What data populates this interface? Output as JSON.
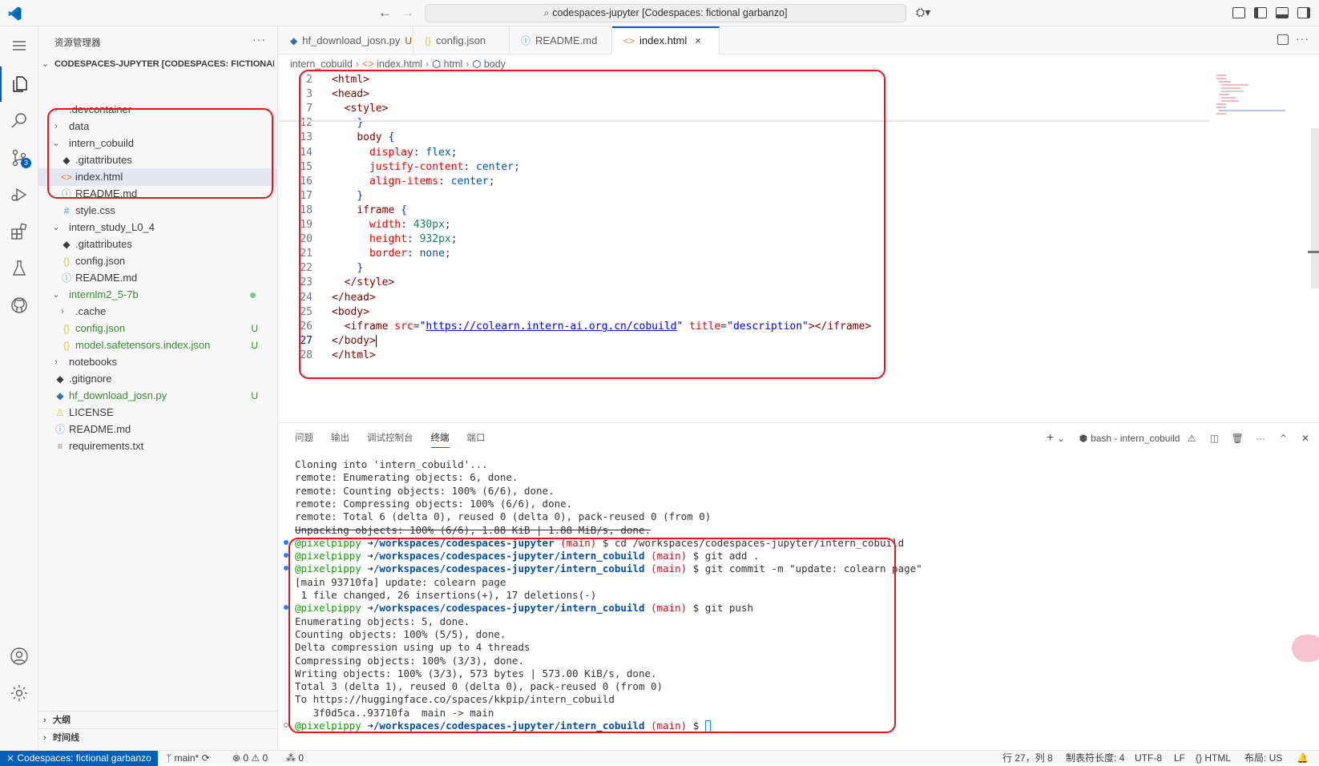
{
  "titlebar": {
    "search_text": "codespaces-jupyter [Codespaces: fictional garbanzo]",
    "back_glyph": "←",
    "forward_glyph": "→",
    "copilot_glyph": "⛭▾"
  },
  "sidebar": {
    "title": "资源管理器",
    "more_glyph": "···",
    "root_label": "CODESPACES-JUPYTER [CODESPACES: FICTIONAL G...",
    "rows": [
      {
        "indent": 1,
        "type": "folder",
        "open": false,
        "name": ".devcontainer",
        "color": "#3b3b3b",
        "status": ""
      },
      {
        "indent": 1,
        "type": "folder",
        "open": false,
        "name": "data",
        "color": "#3b3b3b",
        "status": ""
      },
      {
        "indent": 1,
        "type": "folder",
        "open": true,
        "name": "intern_cobuild",
        "color": "#3b3b3b",
        "status": ""
      },
      {
        "indent": 2,
        "type": "file",
        "icon": "git",
        "name": ".gitattributes",
        "color": "#3b3b3b",
        "status": ""
      },
      {
        "indent": 2,
        "type": "file",
        "icon": "html",
        "name": "index.html",
        "color": "#3b3b3b",
        "status": "",
        "selected": true
      },
      {
        "indent": 2,
        "type": "file",
        "icon": "info",
        "name": "README.md",
        "color": "#3b3b3b",
        "status": ""
      },
      {
        "indent": 2,
        "type": "file",
        "icon": "css",
        "name": "style.css",
        "color": "#3b3b3b",
        "status": ""
      },
      {
        "indent": 1,
        "type": "folder",
        "open": true,
        "name": "intern_study_L0_4",
        "color": "#3b3b3b",
        "status": ""
      },
      {
        "indent": 2,
        "type": "file",
        "icon": "git",
        "name": ".gitattributes",
        "color": "#3b3b3b",
        "status": ""
      },
      {
        "indent": 2,
        "type": "file",
        "icon": "json",
        "name": "config.json",
        "color": "#3b3b3b",
        "status": ""
      },
      {
        "indent": 2,
        "type": "file",
        "icon": "info",
        "name": "README.md",
        "color": "#3b3b3b",
        "status": ""
      },
      {
        "indent": 1,
        "type": "folder",
        "open": true,
        "name": "internlm2_5-7b",
        "color": "#388a34",
        "status": "dot"
      },
      {
        "indent": 2,
        "type": "folder",
        "open": false,
        "name": ".cache",
        "color": "#3b3b3b",
        "status": ""
      },
      {
        "indent": 2,
        "type": "file",
        "icon": "json",
        "name": "config.json",
        "color": "#388a34",
        "status": "U"
      },
      {
        "indent": 2,
        "type": "file",
        "icon": "json",
        "name": "model.safetensors.index.json",
        "color": "#388a34",
        "status": "U"
      },
      {
        "indent": 1,
        "type": "folder",
        "open": false,
        "name": "notebooks",
        "color": "#3b3b3b",
        "status": ""
      },
      {
        "indent": 1,
        "type": "file",
        "icon": "git",
        "name": ".gitignore",
        "color": "#3b3b3b",
        "status": ""
      },
      {
        "indent": 1,
        "type": "file",
        "icon": "py",
        "name": "hf_download_josn.py",
        "color": "#388a34",
        "status": "U"
      },
      {
        "indent": 1,
        "type": "file",
        "icon": "license",
        "name": "LICENSE",
        "color": "#3b3b3b",
        "status": ""
      },
      {
        "indent": 1,
        "type": "file",
        "icon": "info",
        "name": "README.md",
        "color": "#3b3b3b",
        "status": ""
      },
      {
        "indent": 1,
        "type": "file",
        "icon": "txt",
        "name": "requirements.txt",
        "color": "#3b3b3b",
        "status": ""
      }
    ],
    "outline_label": "大纲",
    "timeline_label": "时间线"
  },
  "icons": {
    "git": {
      "glyph": "◆",
      "color": "#3b3b3b"
    },
    "html": {
      "glyph": "<>",
      "color": "#e37933"
    },
    "info": {
      "glyph": "ⓘ",
      "color": "#519aba"
    },
    "css": {
      "glyph": "#",
      "color": "#519aba"
    },
    "json": {
      "glyph": "{}",
      "color": "#cbcb41"
    },
    "py": {
      "glyph": "◆",
      "color": "#3572a5"
    },
    "license": {
      "glyph": "♙",
      "color": "#cbcb41"
    },
    "txt": {
      "glyph": "≡",
      "color": "#888888"
    }
  },
  "tabs": [
    {
      "label": "hf_download_josn.py",
      "icon": "py",
      "status": "U",
      "active": false
    },
    {
      "label": "config.json",
      "icon": "json",
      "status": "",
      "active": false
    },
    {
      "label": "README.md",
      "icon": "info",
      "status": "",
      "active": false
    },
    {
      "label": "index.html",
      "icon": "html",
      "status": "",
      "active": true,
      "close": "×"
    }
  ],
  "breadcrumb": [
    "intern_cobuild",
    "index.html",
    "html",
    "body"
  ],
  "editor": {
    "current_line": "27",
    "lines": [
      {
        "n": "2",
        "tokens": [
          [
            "tag",
            "<html>"
          ]
        ]
      },
      {
        "n": "3",
        "tokens": [
          [
            "tag",
            "<head>"
          ]
        ]
      },
      {
        "n": "7",
        "tokens": [
          [
            "pun",
            "  "
          ],
          [
            "tag",
            "<style>"
          ]
        ]
      },
      {
        "n": "12",
        "tokens": [
          [
            "pun",
            "    "
          ],
          [
            "brk",
            "}"
          ]
        ]
      },
      {
        "n": "13",
        "tokens": [
          [
            "pun",
            "    "
          ],
          [
            "sel",
            "body"
          ],
          [
            "pun",
            " "
          ],
          [
            "brk",
            "{"
          ]
        ]
      },
      {
        "n": "14",
        "tokens": [
          [
            "pun",
            "      "
          ],
          [
            "prop",
            "display"
          ],
          [
            "pun",
            ": "
          ],
          [
            "val",
            "flex"
          ],
          [
            "pun",
            ";"
          ]
        ]
      },
      {
        "n": "15",
        "tokens": [
          [
            "pun",
            "      "
          ],
          [
            "prop",
            "justify-content"
          ],
          [
            "pun",
            ": "
          ],
          [
            "val",
            "center"
          ],
          [
            "pun",
            ";"
          ]
        ]
      },
      {
        "n": "16",
        "tokens": [
          [
            "pun",
            "      "
          ],
          [
            "prop",
            "align-items"
          ],
          [
            "pun",
            ": "
          ],
          [
            "val",
            "center"
          ],
          [
            "pun",
            ";"
          ]
        ]
      },
      {
        "n": "17",
        "tokens": [
          [
            "pun",
            "    "
          ],
          [
            "brk",
            "}"
          ]
        ]
      },
      {
        "n": "18",
        "tokens": [
          [
            "pun",
            "    "
          ],
          [
            "sel",
            "iframe"
          ],
          [
            "pun",
            " "
          ],
          [
            "brk",
            "{"
          ]
        ]
      },
      {
        "n": "19",
        "tokens": [
          [
            "pun",
            "      "
          ],
          [
            "prop",
            "width"
          ],
          [
            "pun",
            ": "
          ],
          [
            "num",
            "430px"
          ],
          [
            "pun",
            ";"
          ]
        ]
      },
      {
        "n": "20",
        "tokens": [
          [
            "pun",
            "      "
          ],
          [
            "prop",
            "height"
          ],
          [
            "pun",
            ": "
          ],
          [
            "num",
            "932px"
          ],
          [
            "pun",
            ";"
          ]
        ]
      },
      {
        "n": "21",
        "tokens": [
          [
            "pun",
            "      "
          ],
          [
            "prop",
            "border"
          ],
          [
            "pun",
            ": "
          ],
          [
            "val",
            "none"
          ],
          [
            "pun",
            ";"
          ]
        ]
      },
      {
        "n": "22",
        "tokens": [
          [
            "pun",
            "    "
          ],
          [
            "brk",
            "}"
          ]
        ]
      },
      {
        "n": "23",
        "tokens": [
          [
            "pun",
            "  "
          ],
          [
            "tag",
            "</style>"
          ]
        ]
      },
      {
        "n": "24",
        "tokens": [
          [
            "tag",
            "</head>"
          ]
        ]
      },
      {
        "n": "25",
        "tokens": [
          [
            "tag",
            "<body>"
          ]
        ]
      },
      {
        "n": "26",
        "tokens": [
          [
            "pun",
            "  "
          ],
          [
            "tag",
            "<iframe "
          ],
          [
            "attr",
            "src"
          ],
          [
            "pun",
            "="
          ],
          [
            "str",
            "\""
          ],
          [
            "url",
            "https://colearn.intern-ai.org.cn/cobuild"
          ],
          [
            "str",
            "\""
          ],
          [
            "pun",
            " "
          ],
          [
            "attr",
            "title"
          ],
          [
            "pun",
            "="
          ],
          [
            "str",
            "\"description\""
          ],
          [
            "tag",
            "></iframe>"
          ]
        ]
      },
      {
        "n": "27",
        "tokens": [
          [
            "tag",
            "</body>"
          ]
        ]
      },
      {
        "n": "28",
        "tokens": [
          [
            "tag",
            "</html>"
          ]
        ]
      }
    ]
  },
  "panel": {
    "tabs": [
      "问题",
      "输出",
      "调试控制台",
      "终端",
      "端口"
    ],
    "active_tab": "终端",
    "terminal_name": "bash - intern_cobuild",
    "actions": [
      "+",
      "▾",
      "⚠",
      "◫",
      "🗑",
      "···",
      "⌃",
      "✕"
    ]
  },
  "terminal": [
    {
      "dot": "",
      "segs": [
        [
          "cmd",
          "Cloning into 'intern_cobuild'..."
        ]
      ]
    },
    {
      "dot": "",
      "segs": [
        [
          "cmd",
          "remote: Enumerating objects: 6, done."
        ]
      ]
    },
    {
      "dot": "",
      "segs": [
        [
          "cmd",
          "remote: Counting objects: 100% (6/6), done."
        ]
      ]
    },
    {
      "dot": "",
      "segs": [
        [
          "cmd",
          "remote: Compressing objects: 100% (6/6), done."
        ]
      ]
    },
    {
      "dot": "",
      "segs": [
        [
          "cmd",
          "remote: Total 6 (delta 0), reused 0 (delta 0), pack-reused 0 (from 0)"
        ]
      ]
    },
    {
      "dot": "",
      "segs": [
        [
          "strike",
          "Unpacking objects: 100% (6/6), 1.88 KiB | 1.88 MiB/s, done."
        ]
      ]
    },
    {
      "dot": "blue",
      "segs": [
        [
          "user",
          "@pixelpippy "
        ],
        [
          "cmd",
          "➜"
        ],
        [
          "path",
          "/workspaces/codespaces-jupyter "
        ],
        [
          "br",
          "(main)"
        ],
        [
          "cmd",
          " $ cd /workspaces/codespaces-jupyter/intern_cobuild"
        ]
      ]
    },
    {
      "dot": "blue",
      "segs": [
        [
          "user",
          "@pixelpippy "
        ],
        [
          "cmd",
          "➜"
        ],
        [
          "path",
          "/workspaces/codespaces-jupyter/intern_cobuild "
        ],
        [
          "br",
          "(main)"
        ],
        [
          "cmd",
          " $ git add ."
        ]
      ]
    },
    {
      "dot": "blue",
      "segs": [
        [
          "user",
          "@pixelpippy "
        ],
        [
          "cmd",
          "➜"
        ],
        [
          "path",
          "/workspaces/codespaces-jupyter/intern_cobuild "
        ],
        [
          "br",
          "(main)"
        ],
        [
          "cmd",
          " $ git commit -m \"update: colearn page\""
        ]
      ]
    },
    {
      "dot": "",
      "segs": [
        [
          "cmd",
          "[main 93710fa] update: colearn page"
        ]
      ]
    },
    {
      "dot": "",
      "segs": [
        [
          "cmd",
          " 1 file changed, 26 insertions(+), 17 deletions(-)"
        ]
      ]
    },
    {
      "dot": "blue",
      "segs": [
        [
          "user",
          "@pixelpippy "
        ],
        [
          "cmd",
          "➜"
        ],
        [
          "path",
          "/workspaces/codespaces-jupyter/intern_cobuild "
        ],
        [
          "br",
          "(main)"
        ],
        [
          "cmd",
          " $ git push"
        ]
      ]
    },
    {
      "dot": "",
      "segs": [
        [
          "cmd",
          "Enumerating objects: 5, done."
        ]
      ]
    },
    {
      "dot": "",
      "segs": [
        [
          "cmd",
          "Counting objects: 100% (5/5), done."
        ]
      ]
    },
    {
      "dot": "",
      "segs": [
        [
          "cmd",
          "Delta compression using up to 4 threads"
        ]
      ]
    },
    {
      "dot": "",
      "segs": [
        [
          "cmd",
          "Compressing objects: 100% (3/3), done."
        ]
      ]
    },
    {
      "dot": "",
      "segs": [
        [
          "cmd",
          "Writing objects: 100% (3/3), 573 bytes | 573.00 KiB/s, done."
        ]
      ]
    },
    {
      "dot": "",
      "segs": [
        [
          "cmd",
          "Total 3 (delta 1), reused 0 (delta 0), pack-reused 0 (from 0)"
        ]
      ]
    },
    {
      "dot": "",
      "segs": [
        [
          "cmd",
          "To https://huggingface.co/spaces/kkpip/intern_cobuild"
        ]
      ]
    },
    {
      "dot": "",
      "segs": [
        [
          "cmd",
          "   3f0d5ca..93710fa  main -> main"
        ]
      ]
    },
    {
      "dot": "hollow",
      "segs": [
        [
          "user",
          "@pixelpippy "
        ],
        [
          "cmd",
          "➜"
        ],
        [
          "path",
          "/workspaces/codespaces-jupyter/intern_cobuild "
        ],
        [
          "br",
          "(main)"
        ],
        [
          "cmd",
          " $ "
        ]
      ],
      "cursor": true
    }
  ],
  "statusbar": {
    "remote": "Codespaces: fictional garbanzo",
    "branch": "main*",
    "problems": "⊗ 0 ⚠ 0",
    "ports": "⁂ 0",
    "position": "行 27，列 8",
    "tab_size": "制表符长度: 4",
    "encoding": "UTF-8",
    "eol": "LF",
    "language": "HTML",
    "layout": "布局: US"
  }
}
